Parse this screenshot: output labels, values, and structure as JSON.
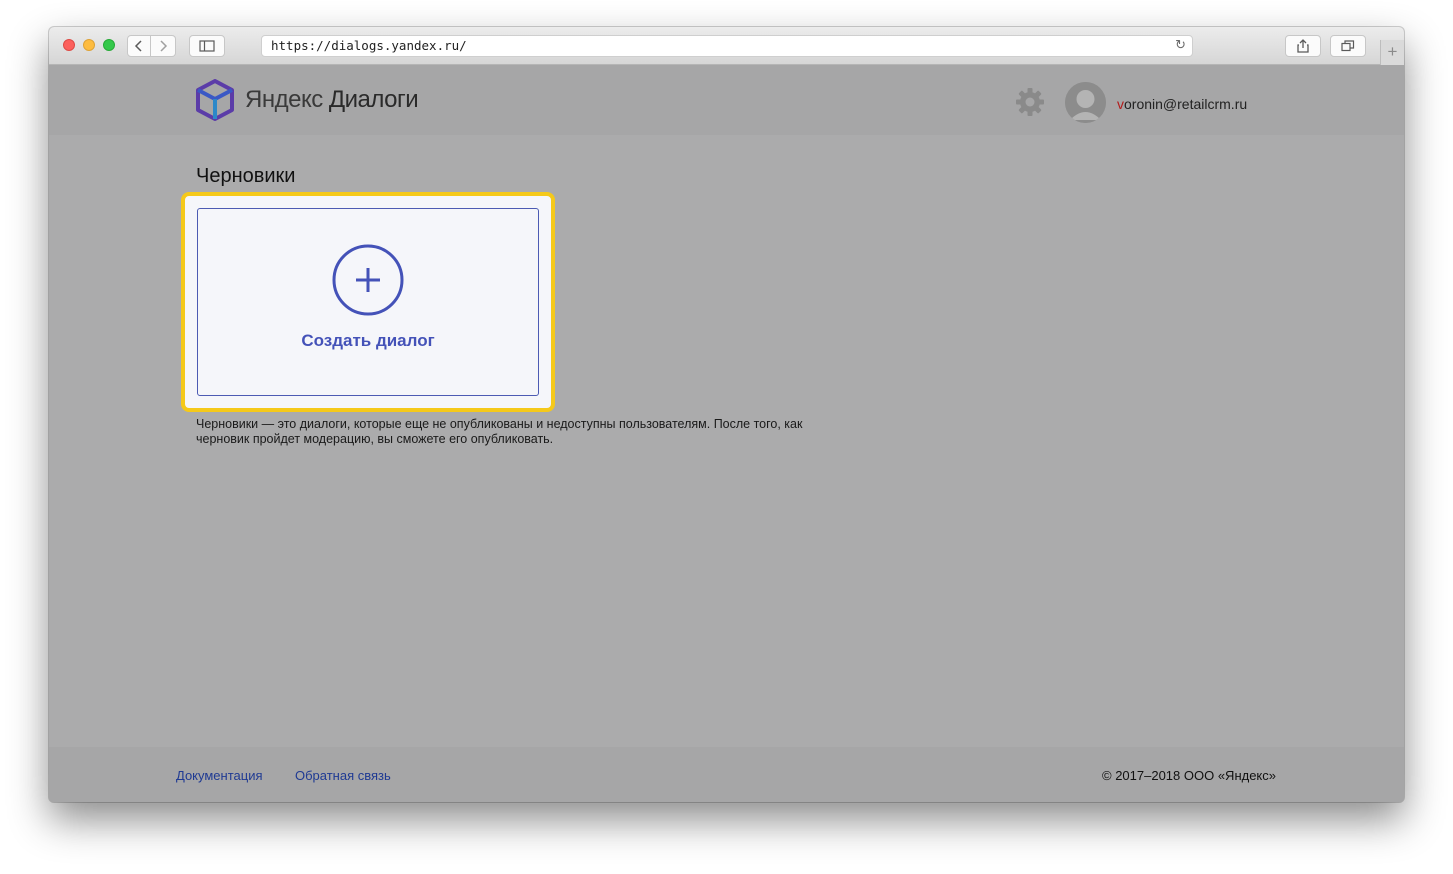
{
  "browser": {
    "url": "https://dialogs.yandex.ru/",
    "back_icon": "chevron-left-icon",
    "forward_icon": "chevron-right-icon",
    "reload_icon": "reload-icon",
    "share_icon": "share-icon",
    "tabs_icon": "tabs-icon",
    "newtab_label": "+"
  },
  "header": {
    "logo_brand": "Яндекс",
    "logo_product": "Диалоги",
    "settings_icon": "gear-icon",
    "avatar_icon": "user-avatar-icon",
    "user_first_letter": "v",
    "user_rest": "oronin@retailcrm.ru"
  },
  "main": {
    "section_title": "Черновики",
    "create_card": {
      "icon": "plus-circle-icon",
      "label": "Создать диалог"
    },
    "hint": "Черновики — это диалоги, которые еще не опубликованы и недоступны пользователям. После того, как черновик пройдет модерацию, вы сможете его опубликовать."
  },
  "footer": {
    "links": [
      "Документация",
      "Обратная связь"
    ],
    "copyright": "© 2017–2018 ООО «Яндекс»"
  },
  "colors": {
    "accent": "#4452b8",
    "highlight": "#f5c91a",
    "overlay": "#ababac"
  }
}
